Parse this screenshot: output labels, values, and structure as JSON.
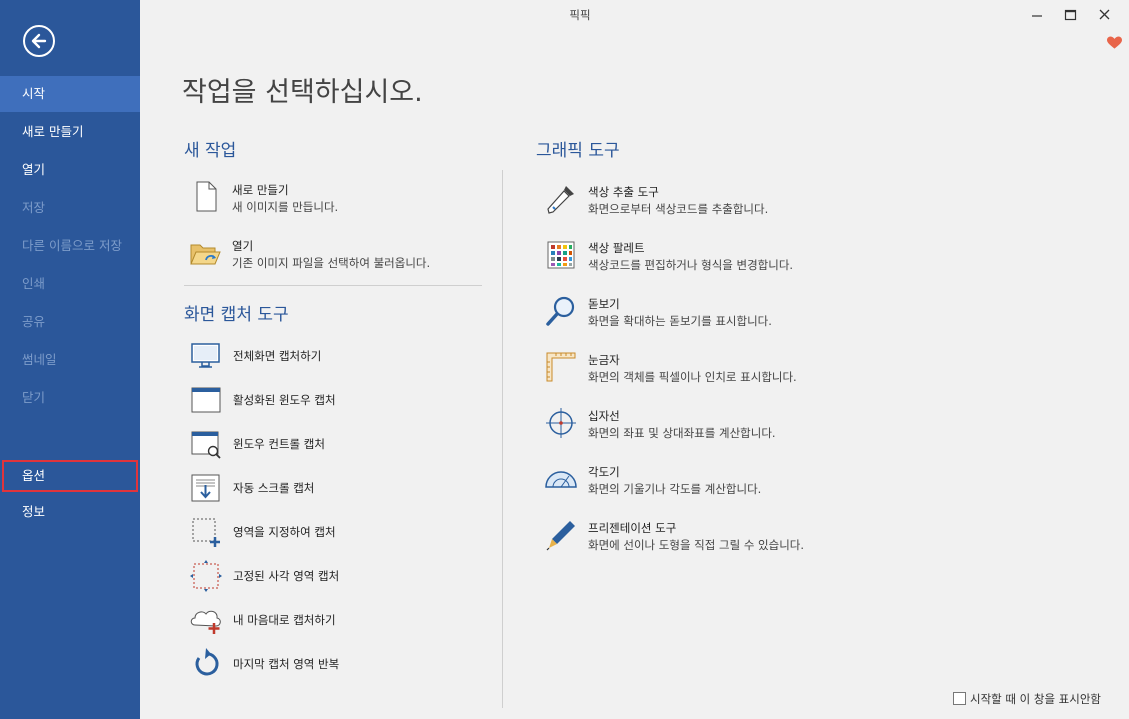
{
  "window": {
    "title": "픽픽"
  },
  "sidebar": {
    "items": [
      {
        "label": "시작"
      },
      {
        "label": "새로 만들기"
      },
      {
        "label": "열기"
      },
      {
        "label": "저장"
      },
      {
        "label": "다른 이름으로 저장"
      },
      {
        "label": "인쇄"
      },
      {
        "label": "공유"
      },
      {
        "label": "썸네일"
      },
      {
        "label": "닫기"
      },
      {
        "label": "옵션"
      },
      {
        "label": "정보"
      }
    ]
  },
  "main": {
    "title": "작업을 선택하십시오.",
    "new_task": {
      "title": "새 작업",
      "items": [
        {
          "label": "새로 만들기",
          "desc": "새 이미지를 만듭니다."
        },
        {
          "label": "열기",
          "desc": "기존 이미지 파일을 선택하여 불러옵니다."
        }
      ]
    },
    "capture": {
      "title": "화면 캡처 도구",
      "items": [
        {
          "label": "전체화면 캡처하기"
        },
        {
          "label": "활성화된 윈도우 캡처"
        },
        {
          "label": "윈도우 컨트롤 캡처"
        },
        {
          "label": "자동 스크롤 캡처"
        },
        {
          "label": "영역을 지정하여 캡처"
        },
        {
          "label": "고정된 사각 영역 캡처"
        },
        {
          "label": "내 마음대로 캡처하기"
        },
        {
          "label": "마지막 캡처 영역 반복"
        }
      ]
    },
    "graphic": {
      "title": "그래픽 도구",
      "items": [
        {
          "label": "색상 추출 도구",
          "desc": "화면으로부터 색상코드를 추출합니다."
        },
        {
          "label": "색상 팔레트",
          "desc": "색상코드를 편집하거나 형식을 변경합니다."
        },
        {
          "label": "돋보기",
          "desc": "화면을 확대하는 돋보기를 표시합니다."
        },
        {
          "label": "눈금자",
          "desc": "화면의 객체를 픽셀이나 인치로 표시합니다."
        },
        {
          "label": "십자선",
          "desc": "화면의 좌표 및 상대좌표를 계산합니다."
        },
        {
          "label": "각도기",
          "desc": "화면의 기울기나 각도를 계산합니다."
        },
        {
          "label": "프리젠테이션 도구",
          "desc": "화면에 선이나 도형을 직접 그릴 수 있습니다."
        }
      ]
    }
  },
  "footer": {
    "checkbox_label": "시작할 때 이 창을 표시안함",
    "checked": false
  },
  "colors": {
    "sidebar": "#2b579a",
    "active": "#3f6fbc",
    "accent": "#2b579a",
    "highlight": "#e0343c",
    "heart": "#e8654a"
  }
}
